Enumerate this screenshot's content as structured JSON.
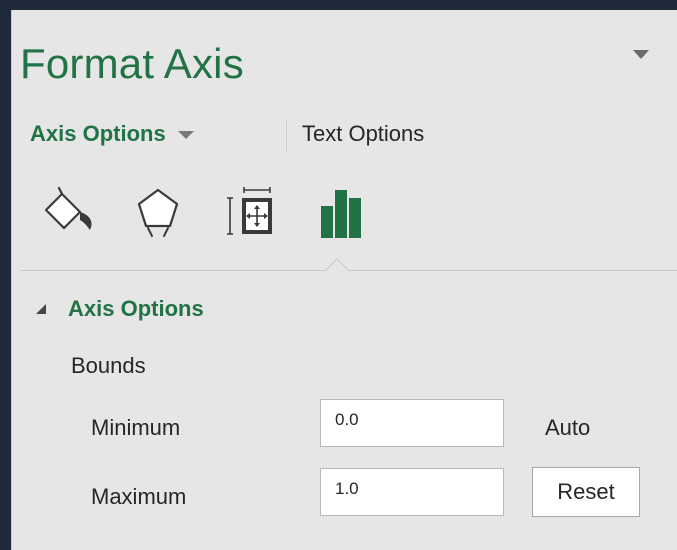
{
  "panel": {
    "title": "Format Axis",
    "menu_icon": "chevron-down-icon",
    "tabs": [
      {
        "label": "Axis Options",
        "active": true
      },
      {
        "label": "Text Options",
        "active": false
      }
    ],
    "category_icons": [
      "fill-line-icon",
      "effects-pentagon-icon",
      "size-properties-icon",
      "axis-options-bar-chart-icon"
    ],
    "selected_category": "axis-options-bar-chart-icon"
  },
  "section": {
    "title": "Axis Options",
    "expanded": true,
    "group_label": "Bounds",
    "rows": [
      {
        "label": "Minimum",
        "value": "0.0",
        "status": "Auto"
      },
      {
        "label": "Maximum",
        "value": "1.0",
        "action": "Reset"
      }
    ]
  },
  "colors": {
    "accent": "#217346",
    "background": "#e6e6e6",
    "window_backdrop": "#1f2b3a"
  }
}
